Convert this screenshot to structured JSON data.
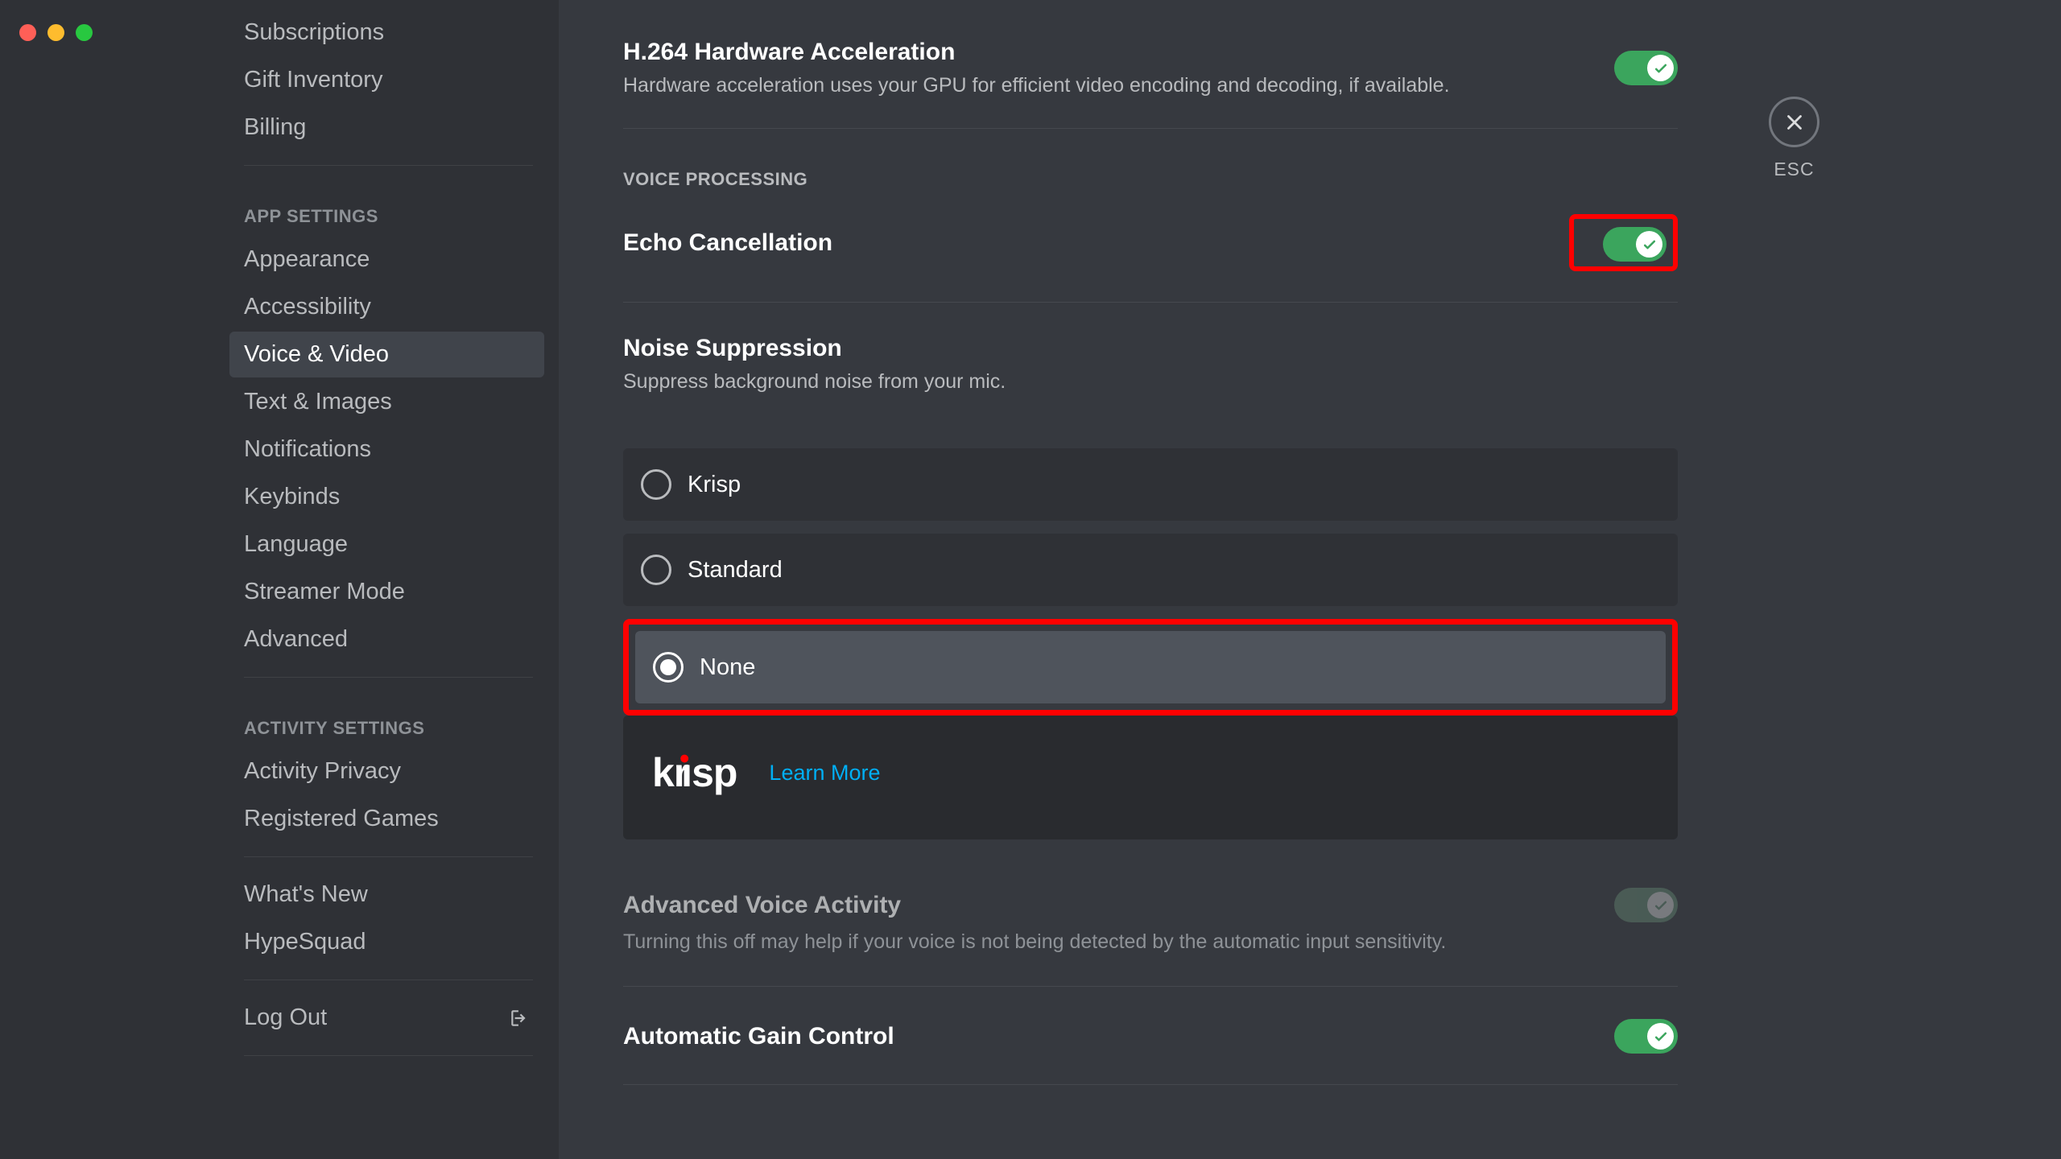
{
  "sidebar": {
    "top_items": [
      "Subscriptions",
      "Gift Inventory",
      "Billing"
    ],
    "app_header": "APP SETTINGS",
    "app_items": [
      "Appearance",
      "Accessibility",
      "Voice & Video",
      "Text & Images",
      "Notifications",
      "Keybinds",
      "Language",
      "Streamer Mode",
      "Advanced"
    ],
    "activity_header": "ACTIVITY SETTINGS",
    "activity_items": [
      "Activity Privacy",
      "Registered Games"
    ],
    "misc_items": [
      "What's New",
      "HypeSquad"
    ],
    "logout": "Log Out"
  },
  "close": {
    "esc": "ESC"
  },
  "hwaccel": {
    "title": "H.264 Hardware Acceleration",
    "desc": "Hardware acceleration uses your GPU for efficient video encoding and decoding, if available."
  },
  "voice_proc_header": "VOICE PROCESSING",
  "echo": {
    "title": "Echo Cancellation"
  },
  "noise": {
    "title": "Noise Suppression",
    "desc": "Suppress background noise from your mic.",
    "options": [
      "Krisp",
      "Standard",
      "None"
    ],
    "selected": "None",
    "learn_more": "Learn More"
  },
  "ava": {
    "title": "Advanced Voice Activity",
    "desc": "Turning this off may help if your voice is not being detected by the automatic input sensitivity."
  },
  "agc": {
    "title": "Automatic Gain Control"
  }
}
